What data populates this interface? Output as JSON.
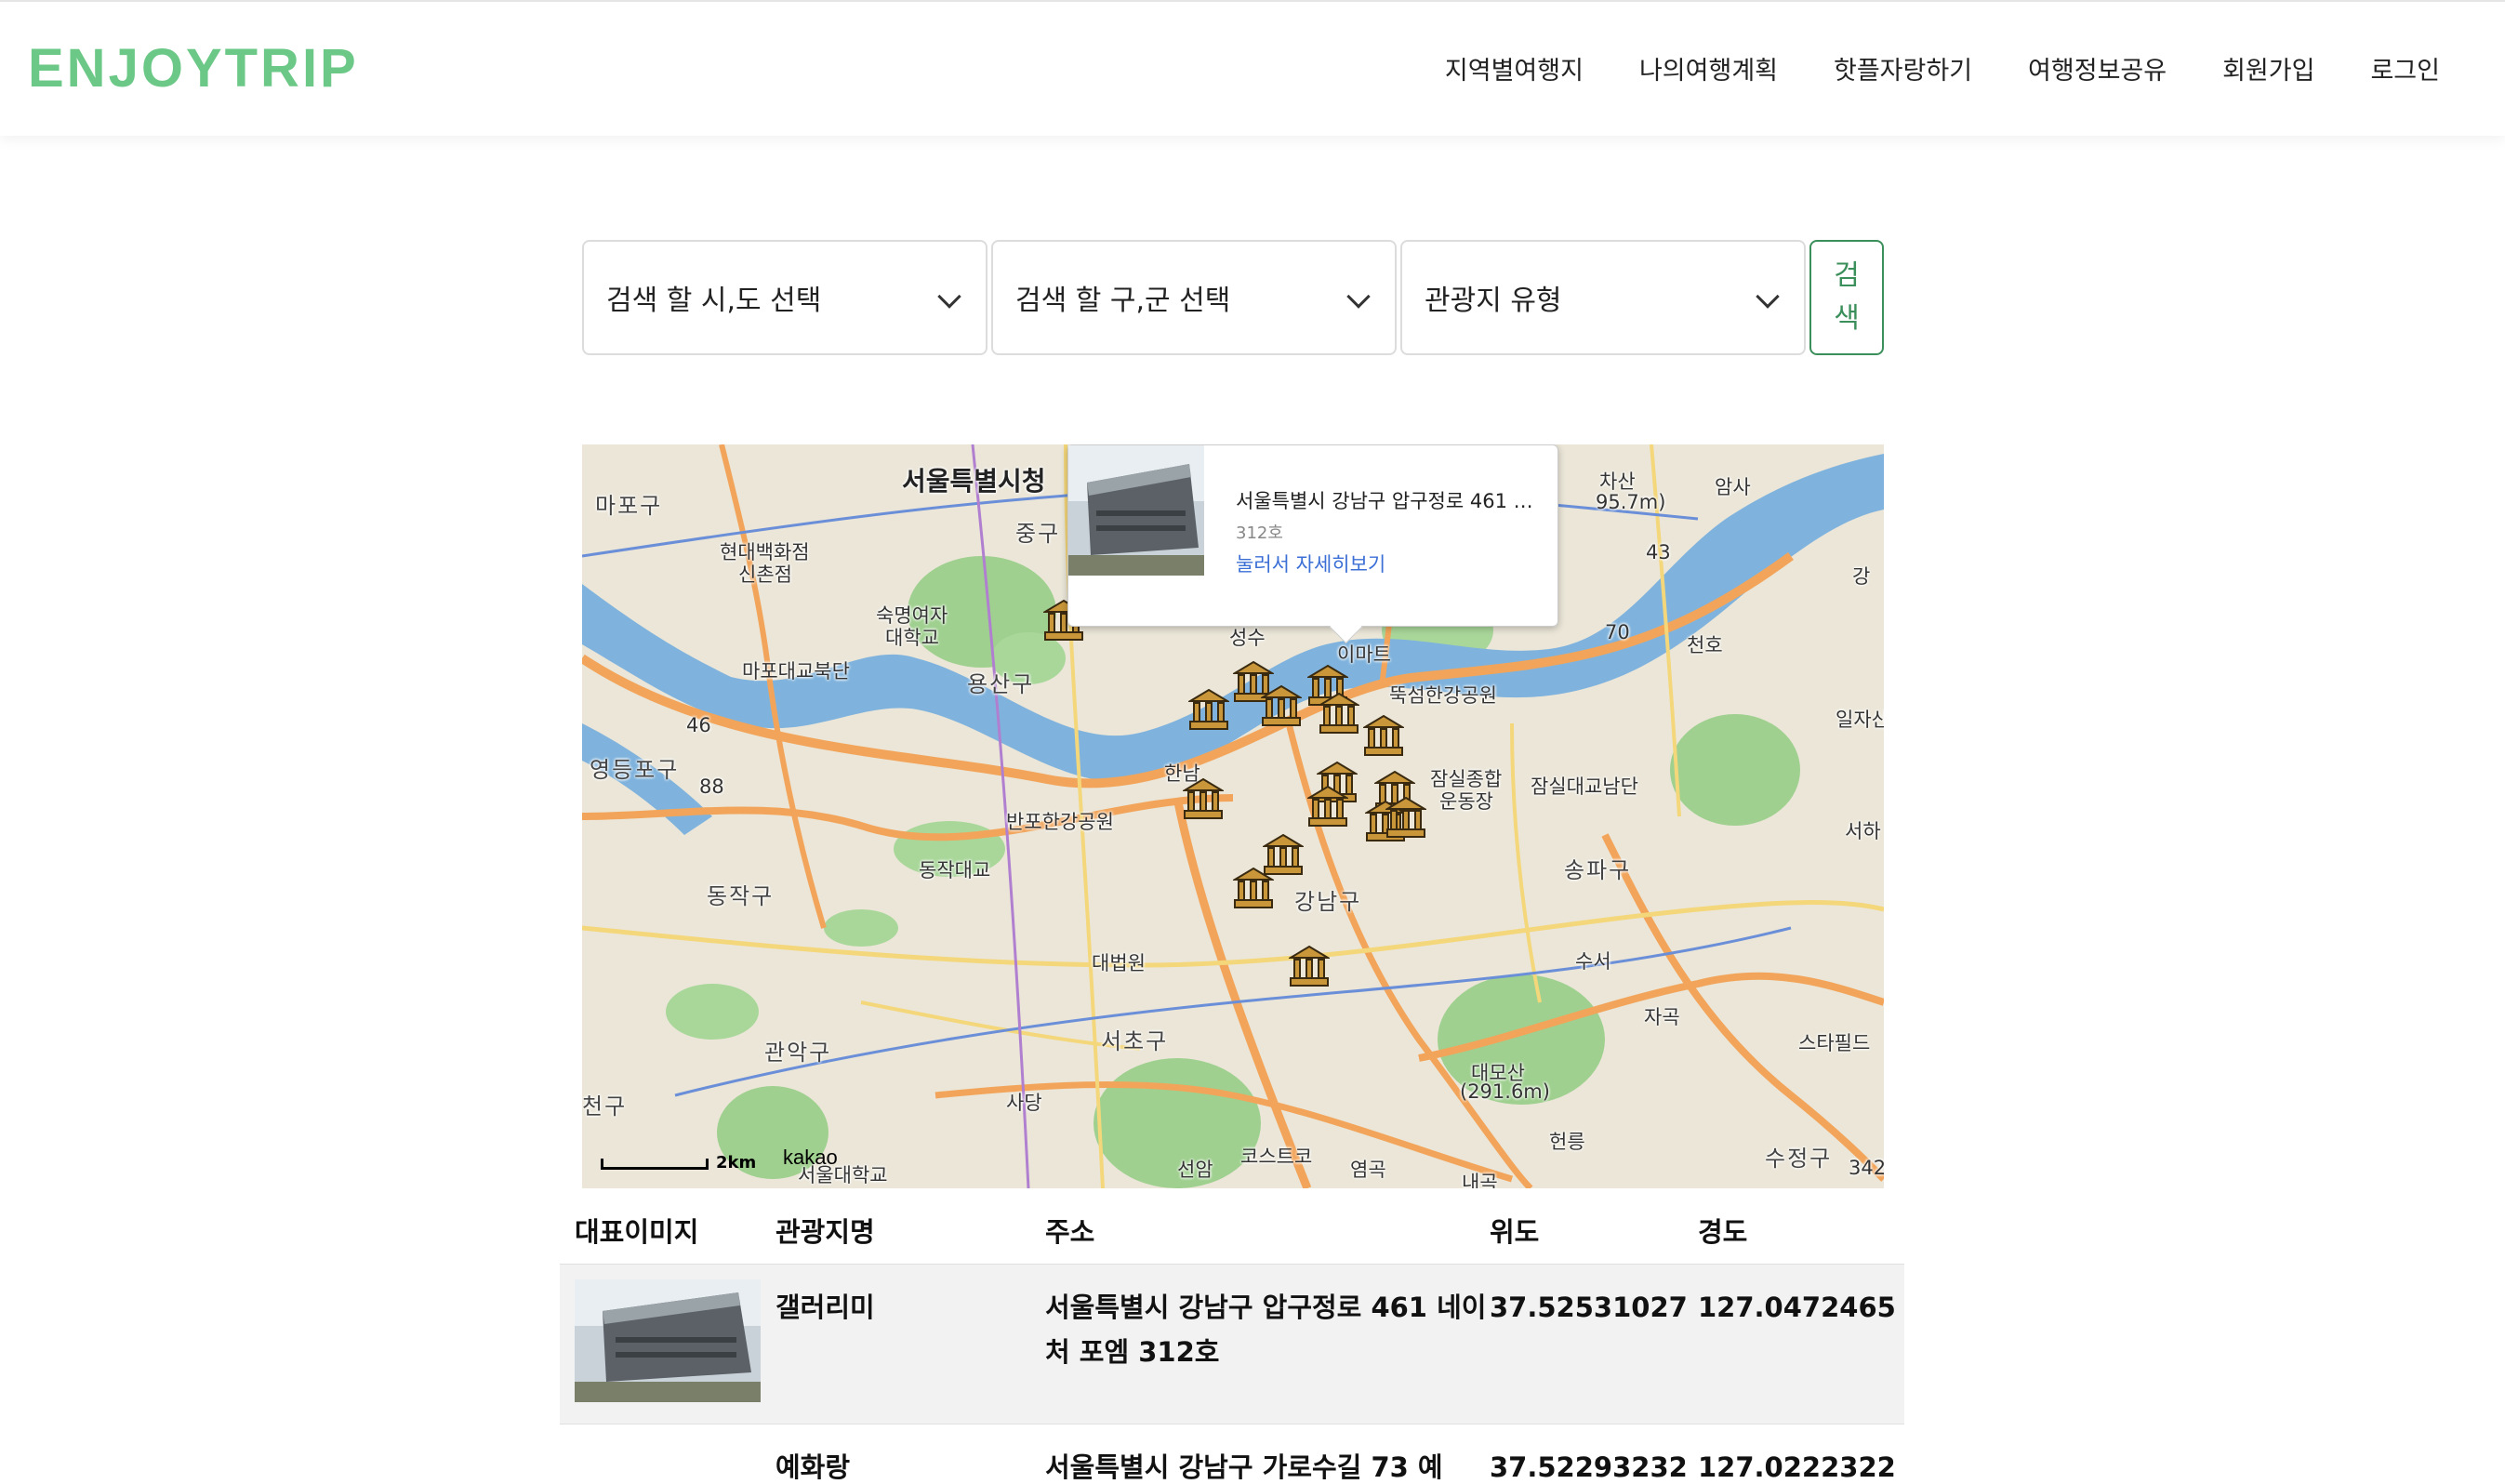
{
  "header": {
    "logo": "ENJOYTRIP",
    "nav": [
      "지역별여행지",
      "나의여행계획",
      "핫플자랑하기",
      "여행정보공유",
      "회원가입",
      "로그인"
    ]
  },
  "search": {
    "sido_placeholder": "검색 할 시,도 선택",
    "gugun_placeholder": "검색 할 구,군 선택",
    "type_placeholder": "관광지 유형",
    "button": "검색"
  },
  "map": {
    "labels": [
      "서울특별시청",
      "마포구",
      "현대백화점",
      "신촌점",
      "숙명여자",
      "대학교",
      "중구",
      "마포대교북단",
      "용산구",
      "영등포구",
      "이마트",
      "뚝섬한강공원",
      "한남",
      "반포한강공원",
      "동작대교",
      "동작구",
      "잠실종합",
      "운동장",
      "잠실대교남단",
      "송파구",
      "강남구",
      "대법원",
      "서초구",
      "관악구",
      "사당",
      "수서",
      "자곡",
      "대모산",
      "(291.6m)",
      "헌릉",
      "스타필드",
      "수정구",
      "암사",
      "천호",
      "일자산",
      "서하",
      "차산",
      "95.7m)",
      "선암",
      "코스트코",
      "염곡",
      "내곡",
      "서울대학교",
      "천구",
      "성수",
      "강",
      "88",
      "46",
      "43",
      "70",
      "342"
    ],
    "popup": {
      "address": "서울특별시 강남구 압구정로 461 네이처 포엠",
      "zip": "312호",
      "link": "눌러서 자세히보기"
    },
    "scale": "2km",
    "brand": "kakao",
    "marker_icon": "museum-marker-icon"
  },
  "table": {
    "headers": [
      "대표이미지",
      "관광지명",
      "주소",
      "위도",
      "경도"
    ],
    "rows": [
      {
        "name": "갤러리미",
        "address": "서울특별시 강남구 압구정로 461 네이처 포엠 312호",
        "lat": "37.52531027",
        "lng": "127.0472465"
      },
      {
        "name": "예화랑",
        "address": "서울특별시 강남구 가로수길 73 예",
        "lat": "37.52293232",
        "lng": "127.0222322"
      }
    ]
  }
}
